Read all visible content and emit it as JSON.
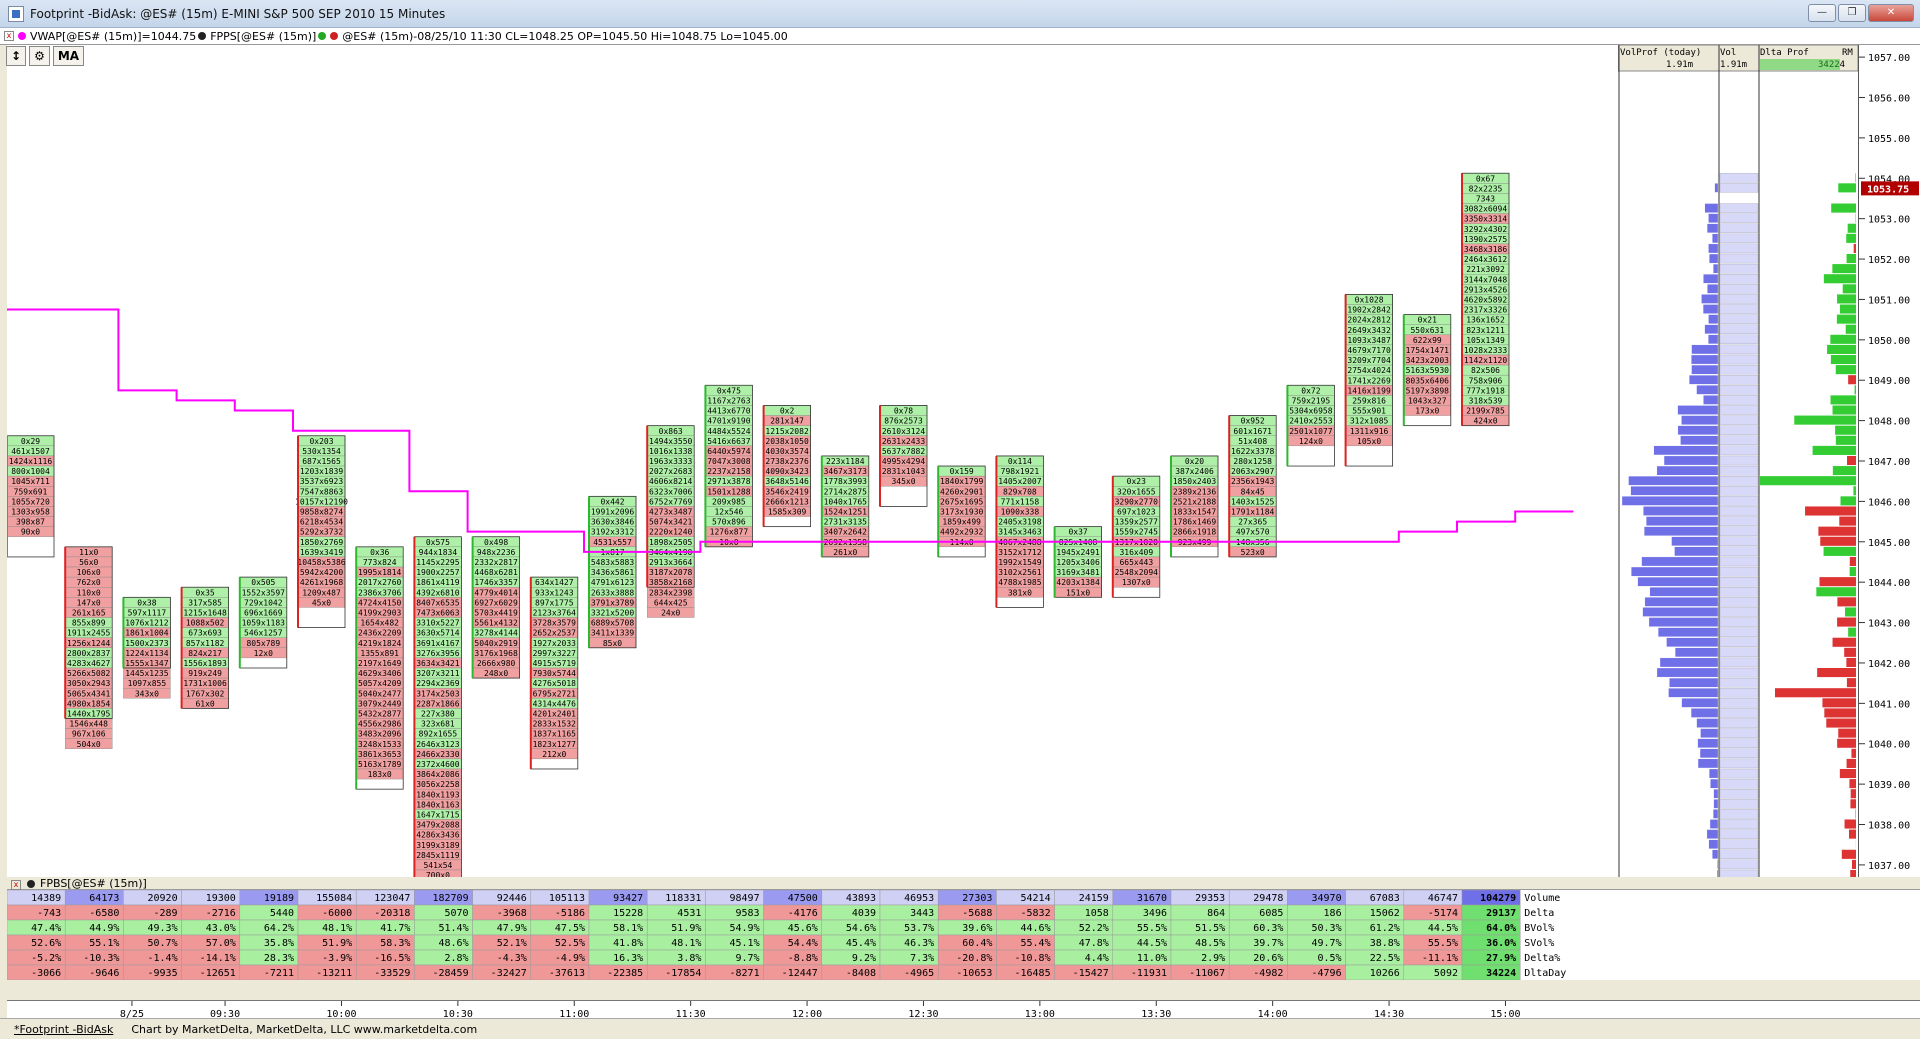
{
  "window": {
    "title": "Footprint  -BidAsk: @ES# (15m) E-MINI S&P 500 SEP 2010 15 Minutes"
  },
  "infobar": {
    "vwap": "VWAP[@ES# (15m)]=1044.75",
    "fpps": "FPPS[@ES# (15m)]",
    "bar": "@ES# (15m)-08/25/10 11:30 CL=1048.25 OP=1045.50 Hi=1048.75 Lo=1045.00"
  },
  "toolbar": {
    "ma_label": "MA"
  },
  "profile_header": {
    "volprof": "VolProf (today)",
    "vol": "Vol",
    "dlta": "Dlta Prof",
    "rm": "RM",
    "volprof_val": "1.91m",
    "vol_val": "1.91m",
    "dlta_val": "34224"
  },
  "price_axis": {
    "labels": [
      "1057.00",
      "1056.00",
      "1055.00",
      "1054.00",
      "1053.00",
      "1052.00",
      "1051.00",
      "1050.00",
      "1049.00",
      "1048.00",
      "1047.00",
      "1046.00",
      "1045.00",
      "1044.00",
      "1043.00",
      "1042.00",
      "1041.00",
      "1040.00",
      "1039.00",
      "1038.00",
      "1037.00"
    ],
    "current": "1053.75"
  },
  "subpanel": {
    "title": "FPBS[@ES# (15m)]"
  },
  "stats": {
    "labels": [
      "Volume",
      "Delta",
      "BVol%",
      "SVol%",
      "Delta%",
      "DltaDay"
    ],
    "rows": [
      [
        "14389",
        "64173",
        "20920",
        "19300",
        "19189",
        "155084",
        "123047",
        "182709",
        "92446",
        "105113",
        "93427",
        "118331",
        "98497",
        "47500",
        "43893",
        "46953",
        "27303",
        "54214",
        "24159",
        "31670",
        "29353",
        "29478",
        "34970",
        "67083",
        "46747",
        "104279"
      ],
      [
        "-743",
        "-6580",
        "-289",
        "-2716",
        "5440",
        "-6000",
        "-20318",
        "5070",
        "-3968",
        "-5186",
        "15228",
        "4531",
        "9583",
        "-4176",
        "4039",
        "3443",
        "-5688",
        "-5832",
        "1058",
        "3496",
        "864",
        "6085",
        "186",
        "15062",
        "-5174",
        "29137"
      ],
      [
        "47.4%",
        "44.9%",
        "49.3%",
        "43.0%",
        "64.2%",
        "48.1%",
        "41.7%",
        "51.4%",
        "47.9%",
        "47.5%",
        "58.1%",
        "51.9%",
        "54.9%",
        "45.6%",
        "54.6%",
        "53.7%",
        "39.6%",
        "44.6%",
        "52.2%",
        "55.5%",
        "51.5%",
        "60.3%",
        "50.3%",
        "61.2%",
        "44.5%",
        "64.0%"
      ],
      [
        "52.6%",
        "55.1%",
        "50.7%",
        "57.0%",
        "35.8%",
        "51.9%",
        "58.3%",
        "48.6%",
        "52.1%",
        "52.5%",
        "41.8%",
        "48.1%",
        "45.1%",
        "54.4%",
        "45.4%",
        "46.3%",
        "60.4%",
        "55.4%",
        "47.8%",
        "44.5%",
        "48.5%",
        "39.7%",
        "49.7%",
        "38.8%",
        "55.5%",
        "36.0%"
      ],
      [
        "-5.2%",
        "-10.3%",
        "-1.4%",
        "-14.1%",
        "28.3%",
        "-3.9%",
        "-16.5%",
        "2.8%",
        "-4.3%",
        "-4.9%",
        "16.3%",
        "3.8%",
        "9.7%",
        "-8.8%",
        "9.2%",
        "7.3%",
        "-20.8%",
        "-10.8%",
        "4.4%",
        "11.0%",
        "2.9%",
        "20.6%",
        "0.5%",
        "22.5%",
        "-11.1%",
        "27.9%"
      ],
      [
        "-3066",
        "-9646",
        "-9935",
        "-12651",
        "-7211",
        "-13211",
        "-33529",
        "-28459",
        "-32427",
        "-37613",
        "-22385",
        "-17854",
        "-8271",
        "-12447",
        "-8408",
        "-4965",
        "-10653",
        "-16485",
        "-15427",
        "-11931",
        "-11067",
        "-4982",
        "-4796",
        "10266",
        "5092",
        "34224"
      ]
    ]
  },
  "time_axis": {
    "labels": [
      "8/25",
      "09:30",
      "10:00",
      "10:30",
      "11:00",
      "11:30",
      "12:00",
      "12:30",
      "13:00",
      "13:30",
      "14:00",
      "14:30",
      "15:00"
    ]
  },
  "footer": {
    "tab": "*Footprint  -BidAsk",
    "credit": "Chart by MarketDelta, MarketDelta, LLC www.marketdelta.com"
  },
  "chart_data": {
    "type": "footprint",
    "symbol": "@ES# (15m)",
    "ylim": [
      1036.75,
      1057.25
    ],
    "bars": [
      {
        "hi": 1047.5,
        "lo": 1044.75,
        "cells": [
          "0x29",
          "461x1507",
          "1424x1116",
          "800x1004",
          "1045x711",
          "759x691",
          "1055x720",
          "1303x958",
          "398x87",
          "90x0"
        ]
      },
      {
        "hi": 1044.75,
        "lo": 1040.75,
        "cells": [
          "11x0",
          "56x0",
          "106x0",
          "762x0",
          "110x0",
          "147x0",
          "261x165",
          "855x899",
          "1911x2455",
          "1256x1244",
          "2800x2837",
          "4283x4627",
          "5266x5082",
          "3050x2943",
          "5065x4341",
          "4980x1854",
          "1440x1795",
          "1546x448",
          "967x106",
          "504x0"
        ]
      },
      {
        "hi": 1043.5,
        "lo": 1042.0,
        "cells": [
          "0x38",
          "597x1117",
          "1076x1212",
          "1861x1004",
          "1500x2373",
          "1224x1134",
          "1555x1347",
          "1445x1235",
          "1097x855",
          "343x0"
        ]
      },
      {
        "hi": 1043.75,
        "lo": 1041.0,
        "cells": [
          "0x35",
          "317x585",
          "1215x1648",
          "1088x502",
          "673x693",
          "857x1182",
          "824x217",
          "1556x1893",
          "919x249",
          "1731x1006",
          "1767x302",
          "61x0"
        ]
      },
      {
        "hi": 1044.0,
        "lo": 1042.0,
        "cells": [
          "0x505",
          "1552x3597",
          "729x1042",
          "696x1669",
          "1059x1183",
          "546x1257",
          "805x789",
          "12x0"
        ]
      },
      {
        "hi": 1047.5,
        "lo": 1043.0,
        "cells": [
          "0x203",
          "530x1354",
          "687x1565",
          "1203x1839",
          "3537x6923",
          "7547x8863",
          "10157x12190",
          "9858x8274",
          "6218x4534",
          "5292x3732",
          "1850x2769",
          "1639x3419",
          "10458x5386",
          "5942x4200",
          "4261x1968",
          "1209x487",
          "45x0"
        ]
      },
      {
        "hi": 1044.75,
        "lo": 1039.0,
        "cells": [
          "0x36",
          "773x824",
          "1995x1814",
          "2017x2760",
          "2386x3706",
          "4724x4150",
          "4199x2903",
          "1654x482",
          "2436x2209",
          "4219x1824",
          "1355x891",
          "2197x1649",
          "4629x3406",
          "5057x4209",
          "5040x2477",
          "3079x2449",
          "5432x2877",
          "4556x2986",
          "3483x2096",
          "3248x1533",
          "3861x3653",
          "5163x1789",
          "183x0"
        ]
      },
      {
        "hi": 1045.0,
        "lo": 1036.75,
        "cells": [
          "0x575",
          "944x1834",
          "1145x2295",
          "1900x2257",
          "1861x4119",
          "4392x6810",
          "8407x6535",
          "7473x6063",
          "3310x5227",
          "3630x5714",
          "3691x4167",
          "3276x3956",
          "3634x3421",
          "3207x3211",
          "2294x2369",
          "3174x2503",
          "2287x1866",
          "227x380",
          "323x681",
          "892x1655",
          "2646x3123",
          "2466x2330",
          "2372x4600",
          "3864x2086",
          "3056x2258",
          "1840x1193",
          "1840x1163",
          "1647x1715",
          "3479x2088",
          "4286x3436",
          "3199x3189",
          "2845x1119",
          "541x54",
          "700x0"
        ]
      },
      {
        "hi": 1045.0,
        "lo": 1041.75,
        "cells": [
          "0x498",
          "948x2236",
          "2332x2817",
          "4468x6281",
          "1746x3357",
          "4779x4014",
          "6927x6029",
          "5703x4419",
          "5561x4132",
          "3278x4144",
          "5040x2919",
          "3176x1968",
          "2666x980",
          "248x0"
        ]
      },
      {
        "hi": 1044.0,
        "lo": 1039.5,
        "cells": [
          "634x1427",
          "933x1243",
          "897x1775",
          "2123x3764",
          "3728x3579",
          "2652x2537",
          "1927x2033",
          "2997x3227",
          "4915x5719",
          "7930x5744",
          "4276x5018",
          "6795x2721",
          "4314x4476",
          "4201x2401",
          "2833x1532",
          "1837x1165",
          "1823x1277",
          "212x0"
        ]
      },
      {
        "hi": 1046.0,
        "lo": 1042.5,
        "cells": [
          "0x442",
          "1991x2096",
          "3630x3846",
          "3192x3312",
          "4531x557",
          "1x817",
          "5483x5883",
          "3436x5861",
          "4791x6123",
          "2633x3888",
          "3791x3789",
          "3321x5200",
          "6889x5708",
          "3411x1339",
          "85x0"
        ]
      },
      {
        "hi": 1047.75,
        "lo": 1044.0,
        "cells": [
          "0x863",
          "1494x3550",
          "1016x1338",
          "1963x3333",
          "2027x2683",
          "4606x8214",
          "6323x7006",
          "6752x7769",
          "4273x3487",
          "5074x3421",
          "2220x1240",
          "1898x2505",
          "3464x4190",
          "2913x3664",
          "3187x2078",
          "3858x2168",
          "2834x2398",
          "644x425",
          "24x0"
        ]
      },
      {
        "hi": 1048.75,
        "lo": 1045.0,
        "cells": [
          "0x475",
          "1167x2763",
          "4413x6770",
          "4701x9190",
          "4484x5524",
          "5416x6637",
          "6440x5974",
          "7047x3008",
          "2237x2158",
          "2971x3878",
          "1501x1288",
          "209x985",
          "12x546",
          "570x896",
          "1276x877",
          "10x0"
        ]
      },
      {
        "hi": 1048.25,
        "lo": 1045.5,
        "cells": [
          "0x2",
          "281x147",
          "1215x2082",
          "2038x1050",
          "4030x3574",
          "2738x2376",
          "4090x3423",
          "3648x5146",
          "3546x2419",
          "2666x1213",
          "1585x309"
        ]
      },
      {
        "hi": 1047.0,
        "lo": 1044.75,
        "cells": [
          "223x1184",
          "3467x3173",
          "1778x3993",
          "2714x2875",
          "1040x1765",
          "1524x1251",
          "2731x3135",
          "3407x2642",
          "2692x1358",
          "261x0"
        ]
      },
      {
        "hi": 1048.25,
        "lo": 1046.0,
        "cells": [
          "0x78",
          "876x2573",
          "2610x3124",
          "2631x2433",
          "5637x7882",
          "4995x4294",
          "2831x1043",
          "345x0"
        ]
      },
      {
        "hi": 1046.75,
        "lo": 1044.75,
        "cells": [
          "0x159",
          "1840x1799",
          "4260x2901",
          "2675x1695",
          "3173x1930",
          "1859x499",
          "4492x2932",
          "114x0"
        ]
      },
      {
        "hi": 1047.0,
        "lo": 1043.5,
        "cells": [
          "0x114",
          "798x1921",
          "1405x2007",
          "829x708",
          "771x1158",
          "1090x338",
          "2405x3198",
          "3145x3463",
          "4067x2488",
          "3152x1712",
          "1992x1549",
          "3102x2561",
          "4788x1985",
          "381x0"
        ]
      },
      {
        "hi": 1045.25,
        "lo": 1043.75,
        "cells": [
          "0x37",
          "825x1408",
          "1945x2491",
          "1205x3406",
          "3169x3481",
          "4203x1384",
          "151x0"
        ]
      },
      {
        "hi": 1046.5,
        "lo": 1043.75,
        "cells": [
          "0x23",
          "320x1655",
          "3290x2770",
          "697x1023",
          "1359x2577",
          "1559x2745",
          "1317x1020",
          "316x409",
          "665x443",
          "2548x2094",
          "1307x0"
        ]
      },
      {
        "hi": 1047.0,
        "lo": 1044.75,
        "cells": [
          "0x20",
          "387x2406",
          "1850x2403",
          "2389x2136",
          "2521x2188",
          "1833x1547",
          "1786x1469",
          "2866x1918",
          "923x499"
        ]
      },
      {
        "hi": 1048.0,
        "lo": 1044.75,
        "cells": [
          "0x952",
          "601x1671",
          "51x408",
          "1622x3378",
          "280x1258",
          "2063x2907",
          "2356x1943",
          "84x45",
          "1403x1525",
          "1791x1184",
          "27x365",
          "497x570",
          "148x356",
          "523x0"
        ]
      },
      {
        "hi": 1048.75,
        "lo": 1047.0,
        "cells": [
          "0x72",
          "759x2195",
          "5304x6958",
          "2410x2553",
          "2501x1077",
          "124x0"
        ]
      },
      {
        "hi": 1051.0,
        "lo": 1047.0,
        "cells": [
          "0x1028",
          "1902x2842",
          "2024x2812",
          "2649x3432",
          "1093x3487",
          "4679x7170",
          "3209x7704",
          "2754x4024",
          "1741x2269",
          "1416x1199",
          "259x816",
          "555x901",
          "312x1085",
          "1311x916",
          "105x0"
        ]
      },
      {
        "hi": 1050.5,
        "lo": 1048.0,
        "cells": [
          "0x21",
          "550x631",
          "622x99",
          "1754x1471",
          "3423x2003",
          "5163x5930",
          "8035x6406",
          "5197x3898",
          "1043x327",
          "173x0"
        ]
      },
      {
        "hi": 1054.0,
        "lo": 1048.0,
        "cells": [
          "0x67",
          "82x2235",
          "7343",
          "3082x6094",
          "3350x3314",
          "3292x4302",
          "1390x2575",
          "3468x3186",
          "2464x3612",
          "221x3092",
          "3144x7048",
          "2913x4526",
          "4620x5892",
          "2317x3326",
          "136x1652",
          "823x1211",
          "105x1349",
          "1028x2333",
          "1142x1120",
          "82x506",
          "758x906",
          "777x1918",
          "318x539",
          "2199x785",
          "424x0"
        ]
      }
    ],
    "vwap_steps": [
      1050.75,
      1050.75,
      1048.75,
      1048.5,
      1048.25,
      1047.75,
      1047.75,
      1046.25,
      1045.25,
      1045.25,
      1044.75,
      1044.75,
      1045.0,
      1045.0,
      1045.0,
      1045.0,
      1045.0,
      1045.0,
      1045.0,
      1045.0,
      1045.0,
      1045.0,
      1045.0,
      1045.0,
      1045.25,
      1045.5,
      1045.75
    ]
  },
  "colors": {
    "green": "#aef0a8",
    "green_dark": "#2eb82e",
    "red": "#f0a0a0",
    "red_dark": "#d22",
    "vwap": "#ff00ff",
    "profile_blue": "#6f6fe8",
    "stat_green": "#a8f0a0",
    "stat_red": "#f09898"
  }
}
